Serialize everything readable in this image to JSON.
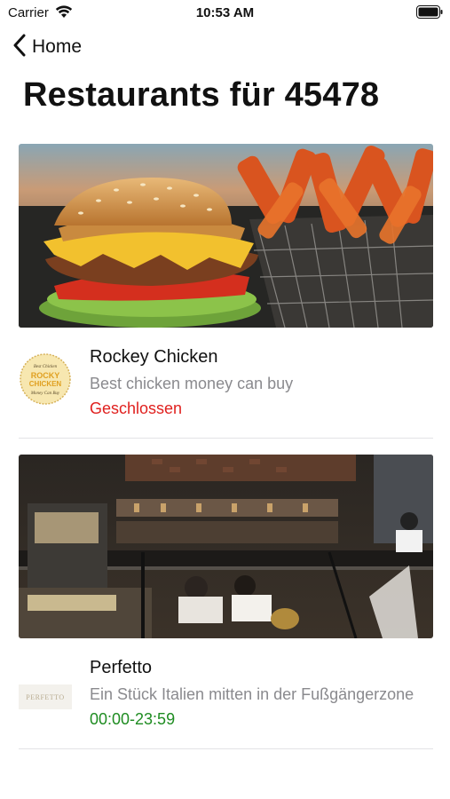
{
  "status_bar": {
    "carrier": "Carrier",
    "time": "10:53 AM",
    "wifi_icon": "wifi-icon",
    "battery_icon": "battery-icon"
  },
  "nav": {
    "back_label": "Home",
    "back_icon": "chevron-left-icon"
  },
  "page": {
    "title": "Restaurants für 45478"
  },
  "restaurants": [
    {
      "name": "Rockey Chicken",
      "description": "Best chicken money can buy",
      "status": "Geschlossen",
      "status_color": "#e0211f",
      "logo_text": [
        "Best Chicken",
        "ROCKY",
        "CHICKEN",
        "Money Can Buy"
      ]
    },
    {
      "name": "Perfetto",
      "description": "Ein Stück Italien mitten in der Fußgängerzone",
      "status": "00:00-23:59",
      "status_color": "#1e8c21",
      "logo_text": [
        "PERFETTO"
      ]
    }
  ]
}
